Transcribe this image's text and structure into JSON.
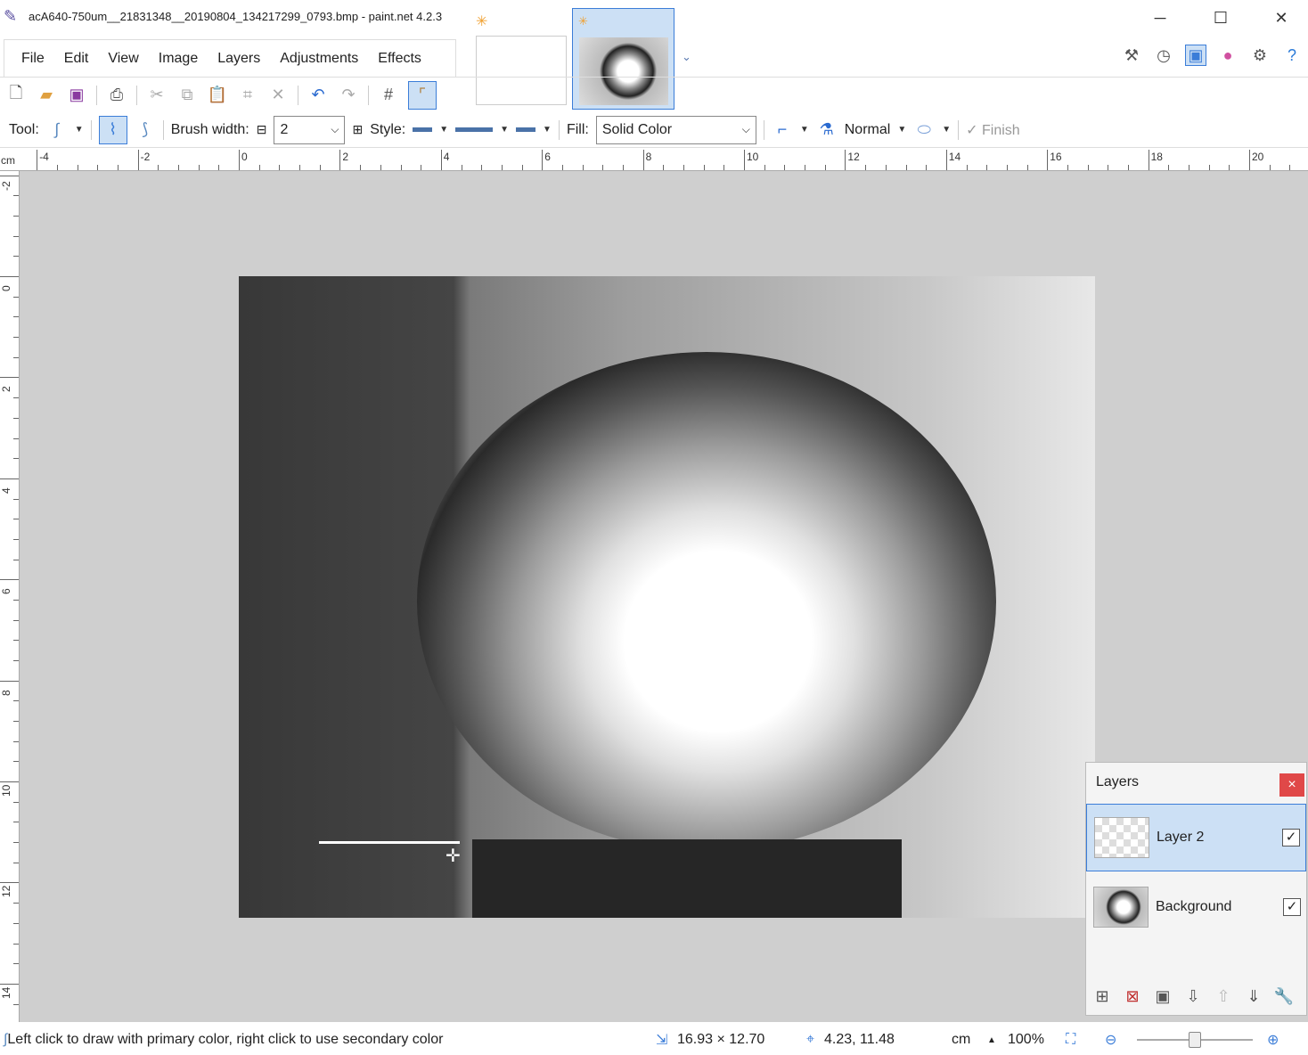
{
  "window": {
    "title": "acA640-750um__21831348__20190804_134217299_0793.bmp - paint.net 4.2.3",
    "minimize": "─",
    "maximize": "☐",
    "close": "✕"
  },
  "menu": [
    "File",
    "Edit",
    "View",
    "Image",
    "Layers",
    "Adjustments",
    "Effects"
  ],
  "toolbar2": {
    "tool_label": "Tool:",
    "brush_width_label": "Brush width:",
    "brush_width_value": "2",
    "style_label": "Style:",
    "fill_label": "Fill:",
    "fill_value": "Solid Color",
    "blend_value": "Normal",
    "finish_label": "Finish"
  },
  "ruler": {
    "unit": "cm",
    "h_labels": [
      "-4",
      "-2",
      "0",
      "2",
      "4",
      "6",
      "8",
      "10",
      "12",
      "14",
      "16",
      "18",
      "20"
    ],
    "v_labels": [
      "-2",
      "0",
      "2",
      "4",
      "6",
      "8",
      "10",
      "12",
      "14"
    ]
  },
  "layers": {
    "title": "Layers",
    "close": "×",
    "items": [
      {
        "name": "Layer 2",
        "visible": true,
        "selected": true
      },
      {
        "name": "Background",
        "visible": true,
        "selected": false
      }
    ]
  },
  "status": {
    "hint": "Left click to draw with primary color, right click to use secondary color",
    "image_size": "16.93 × 12.70",
    "cursor_pos": "4.23, 11.48",
    "unit": "cm",
    "zoom": "100%"
  },
  "colors": {
    "selection": "#cce0f5",
    "accent": "#3b7dd8",
    "close_red": "#e04848"
  }
}
